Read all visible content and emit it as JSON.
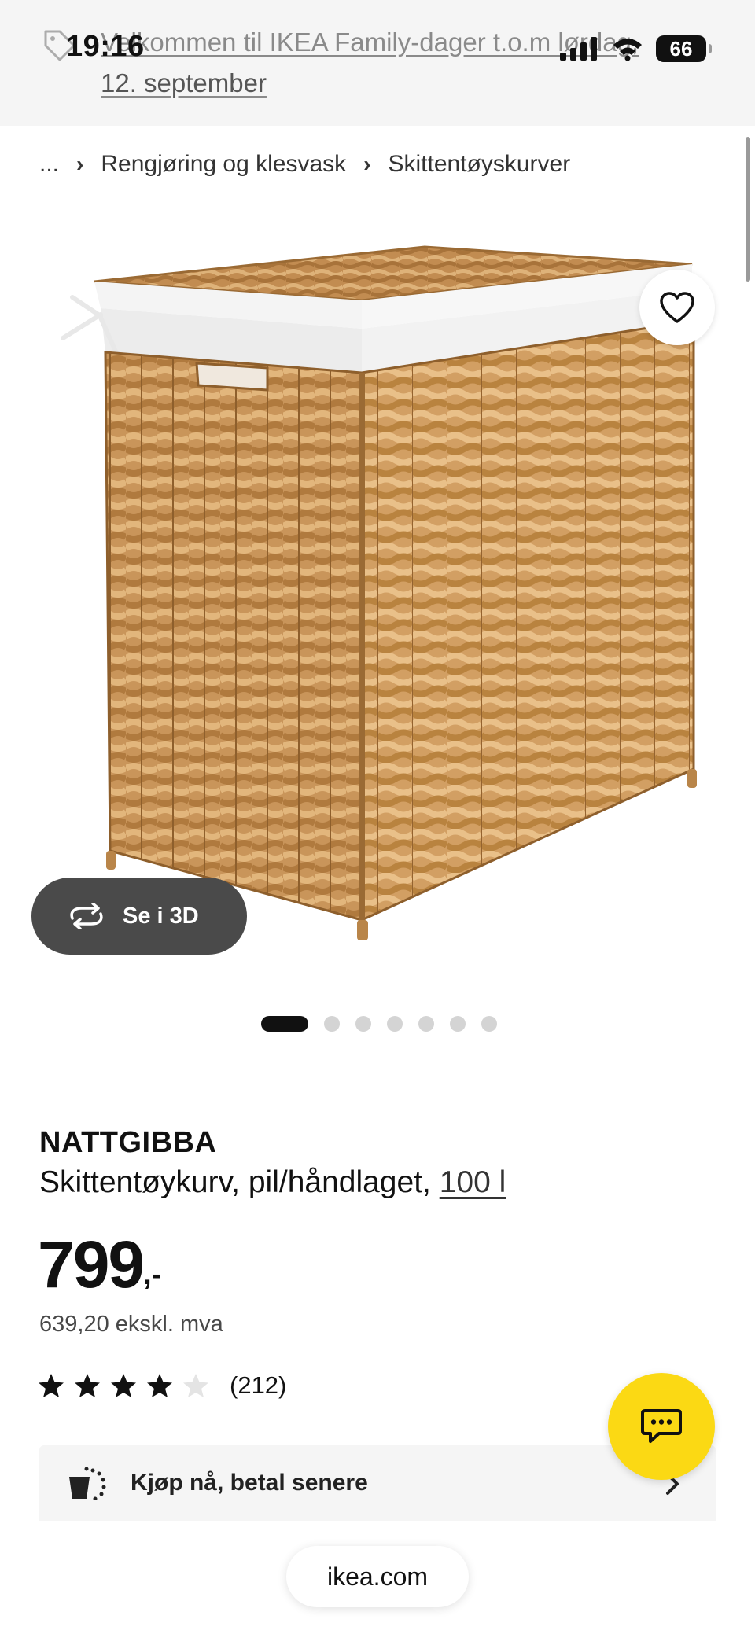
{
  "status_bar": {
    "time": "19:16",
    "battery": "66",
    "icons": [
      "cellular-signal-icon",
      "wifi-icon",
      "battery-icon"
    ]
  },
  "banner": {
    "line1": "Velkommen til IKEA Family-dager t.o.m lørdag,",
    "line2": "12. september",
    "icon": "tag-icon"
  },
  "breadcrumb": {
    "items": [
      "...",
      "Rengjøring og klesvask",
      "Skittentøyskurver"
    ]
  },
  "gallery": {
    "view_3d_label": "Se i 3D",
    "dot_count": 7,
    "active_index": 0
  },
  "product": {
    "name": "NATTGIBBA",
    "description": "Skittentøykurv, pil/håndlaget, ",
    "size_link": "100 l",
    "price": "799",
    "price_suffix": ",-",
    "price_excl_vat": "639,20 ekskl. mva",
    "rating_value": 4,
    "rating_max": 5,
    "rating_count": "(212)"
  },
  "payment": {
    "label": "Kjøp nå, betal senere"
  },
  "browser": {
    "url": "ikea.com"
  },
  "colors": {
    "accent_yellow": "#fbd914",
    "dark_button": "#4a4a4a",
    "text": "#111111"
  }
}
